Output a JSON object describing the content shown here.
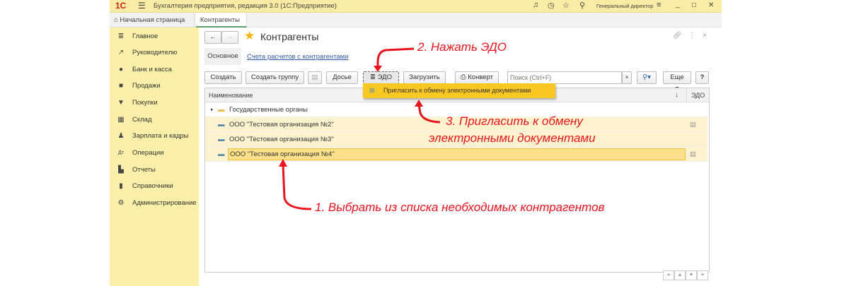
{
  "app": {
    "logo": "1С",
    "title": "Бухгалтерия предприятия, редакция 3.0  (1С:Предприятие)",
    "user": "Генеральный директор"
  },
  "tabs": [
    {
      "label": "Начальная страница"
    },
    {
      "label": "Контрагенты",
      "close": "×"
    }
  ],
  "sidebar": {
    "items": [
      {
        "label": "Главное",
        "icon": "menu-icon"
      },
      {
        "label": "Руководителю",
        "icon": "chart-trend-icon"
      },
      {
        "label": "Банк и касса",
        "icon": "coin-icon"
      },
      {
        "label": "Продажи",
        "icon": "bag-icon"
      },
      {
        "label": "Покупки",
        "icon": "cart-icon"
      },
      {
        "label": "Склад",
        "icon": "warehouse-icon"
      },
      {
        "label": "Зарплата и кадры",
        "icon": "person-icon"
      },
      {
        "label": "Операции",
        "icon": "dt-kt-icon"
      },
      {
        "label": "Отчеты",
        "icon": "bar-chart-icon"
      },
      {
        "label": "Справочники",
        "icon": "book-icon"
      },
      {
        "label": "Администрирование",
        "icon": "gear-icon"
      }
    ]
  },
  "form": {
    "title": "Контрагенты",
    "subtabs": {
      "main": "Основное",
      "link": "Счета расчетов с контрагентами"
    },
    "toolbar": {
      "create": "Создать",
      "create_group": "Создать группу",
      "dossier": "Досье",
      "edo": "ЭДО",
      "load": "Загрузить",
      "envelope": "Конверт",
      "search_placeholder": "Поиск (Ctrl+F)",
      "clear": "×",
      "more": "Еще",
      "help": "?"
    },
    "dropdown": {
      "item": "Пригласить к обмену электронными документами"
    },
    "columns": {
      "name": "Наименование",
      "sort": "↓",
      "edo": "ЭДО"
    },
    "rows": [
      {
        "name": "Государственные органы",
        "type": "group"
      },
      {
        "name": "ООО \"Тестовая организация №2\"",
        "type": "item",
        "edo": true
      },
      {
        "name": "ООО \"Тестовая организация №3\"",
        "type": "item",
        "edo": false
      },
      {
        "name": "ООО \"Тестовая организация №4\"",
        "type": "item",
        "edo": true,
        "selected": true
      }
    ]
  },
  "annotations": {
    "step1": "1. Выбрать из списка необходимых контрагентов",
    "step2": "2. Нажать ЭДО",
    "step3a": "3. Пригласить к обмену",
    "step3b": "электронными документами"
  },
  "colors": {
    "accent_yellow": "#fcefa9",
    "selection": "#fde7a0",
    "annotation": "#e8141e"
  }
}
